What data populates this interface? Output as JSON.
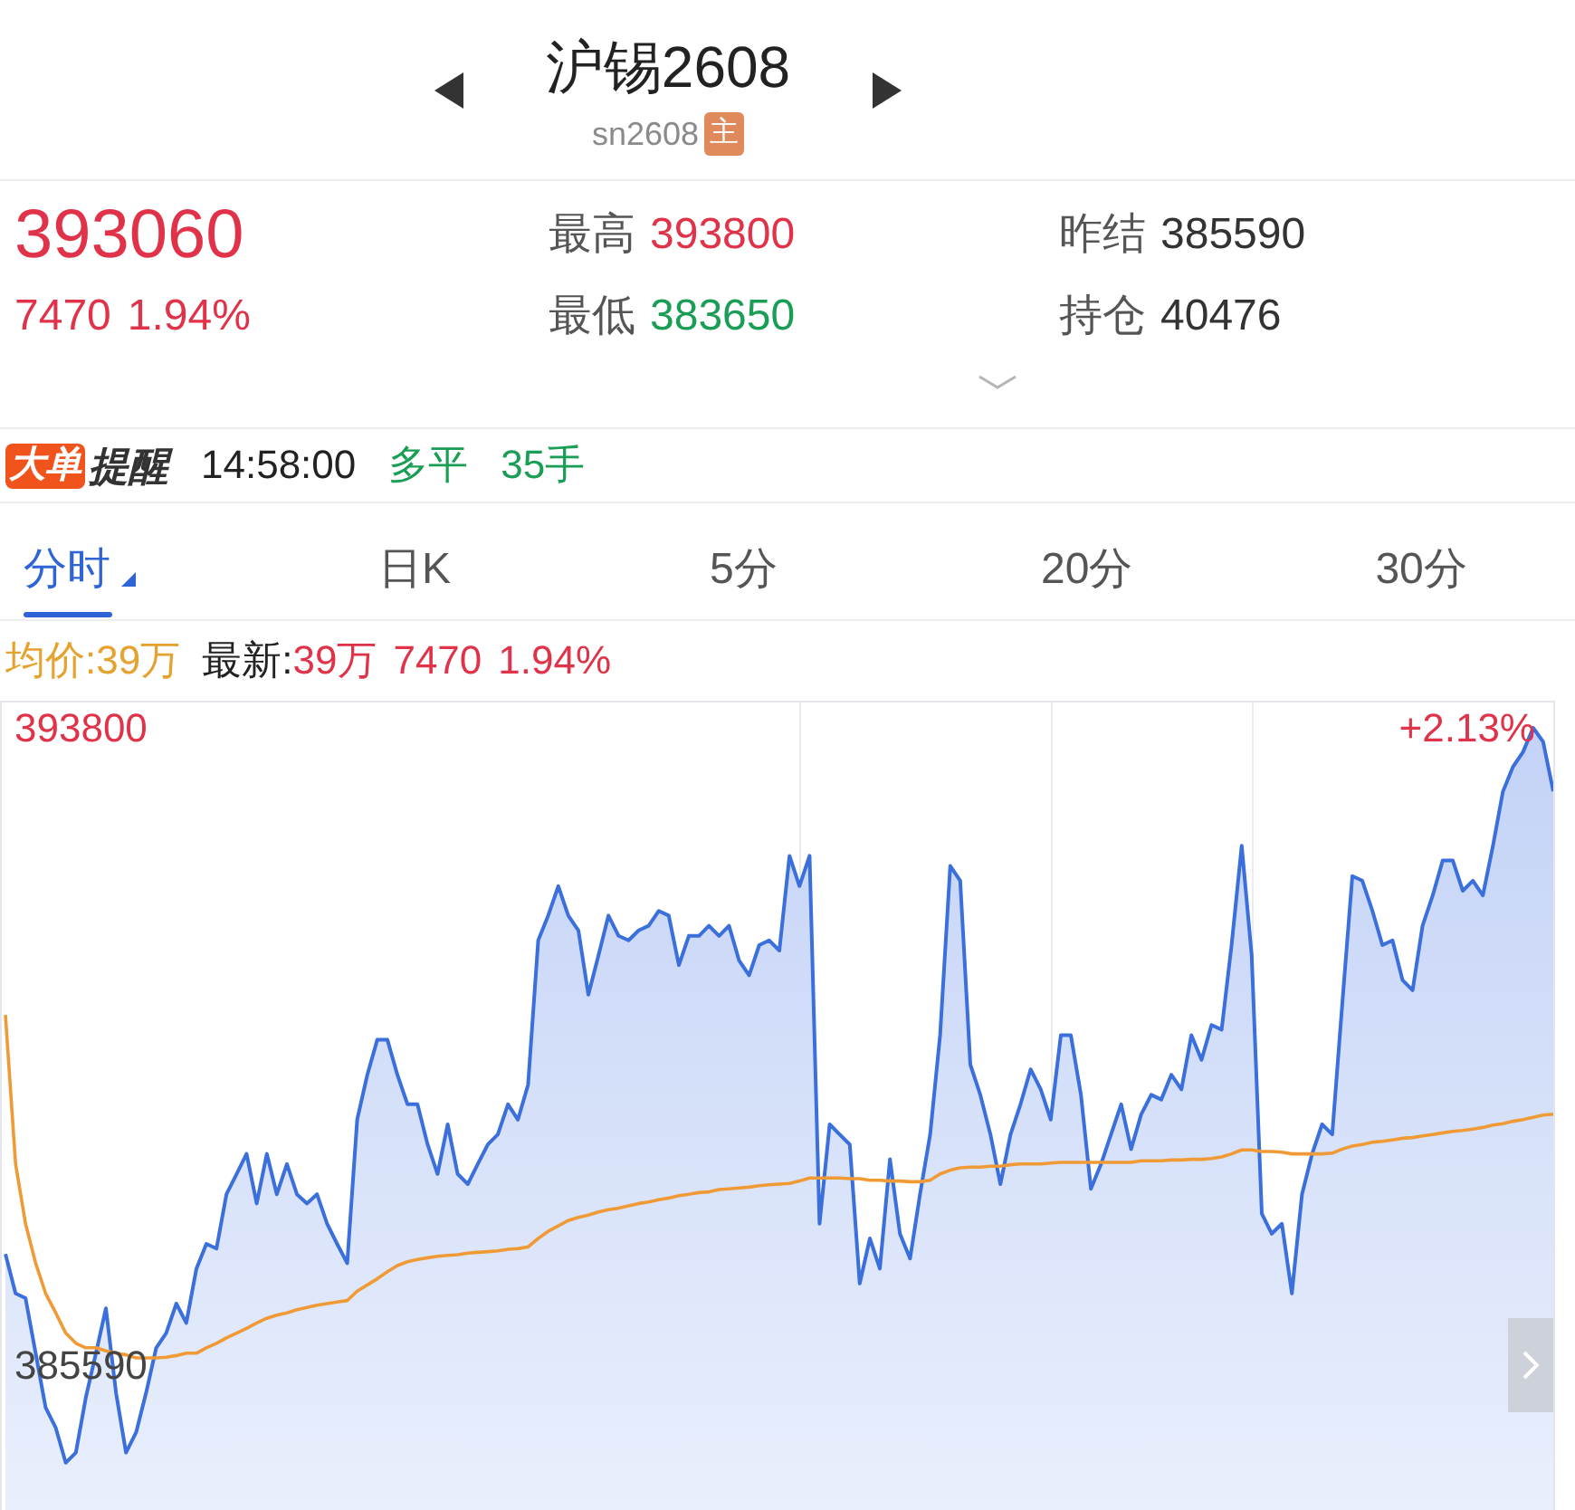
{
  "header": {
    "title": "沪锡2608",
    "code": "sn2608",
    "badge": "主"
  },
  "quote": {
    "price": "393060",
    "change": "7470",
    "change_pct": "1.94%",
    "stats": [
      {
        "label": "最高",
        "value": "393800",
        "color": "#e0334a"
      },
      {
        "label": "昨结",
        "value": "385590",
        "color": "#333333"
      },
      {
        "label": "最低",
        "value": "383650",
        "color": "#1a9e55"
      },
      {
        "label": "持仓",
        "value": "40476",
        "color": "#333333"
      }
    ]
  },
  "alert": {
    "logo_tag": "大单",
    "logo_text": "提醒",
    "time": "14:58:00",
    "action": "多平",
    "volume": "35手"
  },
  "tabs": [
    {
      "label": "分时",
      "selected": true,
      "dropdown": true
    },
    {
      "label": "日K",
      "selected": false,
      "dropdown": false
    },
    {
      "label": "5分",
      "selected": false,
      "dropdown": false
    },
    {
      "label": "20分",
      "selected": false,
      "dropdown": false
    },
    {
      "label": "30分",
      "selected": false,
      "dropdown": false
    }
  ],
  "legend": {
    "average": "均价:39万",
    "latest_label": "最新:",
    "latest_value": "39万",
    "change": "7470",
    "change_pct": "1.94%"
  },
  "chart": {
    "right_label": "+2.13%",
    "chart_data": {
      "type": "area",
      "ylim": [
        383720,
        394150
      ],
      "yticks": [
        {
          "value": 385590,
          "label": "385590"
        },
        {
          "value": 393800,
          "label": "393800"
        }
      ],
      "series": [
        {
          "color": "#3a6fdc",
          "values": [
            387020,
            386510,
            386450,
            385740,
            385040,
            384780,
            384330,
            384460,
            385170,
            385740,
            386320,
            385230,
            384460,
            384720,
            385230,
            385810,
            386000,
            386380,
            386130,
            386830,
            387150,
            387090,
            387790,
            388050,
            388310,
            387670,
            388310,
            387790,
            388180,
            387790,
            387670,
            387790,
            387410,
            387150,
            386900,
            388750,
            389330,
            389780,
            389780,
            389330,
            388950,
            388950,
            388430,
            388050,
            388690,
            388050,
            387920,
            388180,
            388430,
            388560,
            388950,
            388750,
            389200,
            391060,
            391380,
            391760,
            391380,
            391190,
            390360,
            390870,
            391380,
            391120,
            391060,
            391190,
            391250,
            391440,
            391380,
            390740,
            391120,
            391120,
            391250,
            391120,
            391250,
            390800,
            390610,
            391000,
            391060,
            390930,
            392150,
            391760,
            392150,
            387410,
            388690,
            388560,
            388430,
            386640,
            387220,
            386830,
            388240,
            387280,
            386960,
            387790,
            388560,
            389840,
            392020,
            391830,
            389460,
            389070,
            388560,
            387920,
            388560,
            388950,
            389400,
            389140,
            388750,
            389840,
            389840,
            389070,
            387860,
            388180,
            388560,
            388950,
            388370,
            388820,
            389070,
            389010,
            389330,
            389140,
            389840,
            389520,
            389970,
            389910,
            391000,
            392280,
            390870,
            387540,
            387280,
            387410,
            386510,
            387790,
            388310,
            388690,
            388560,
            390230,
            391890,
            391830,
            391440,
            391000,
            391060,
            390550,
            390420,
            391250,
            391640,
            392090,
            392090,
            391700,
            391830,
            391640,
            392280,
            392980,
            393300,
            393490,
            393800,
            393620,
            392980
          ]
        },
        {
          "type": "line",
          "color": "#f09a36",
          "values": [
            390100,
            388180,
            387410,
            386900,
            386510,
            386260,
            386000,
            385870,
            385810,
            385810,
            385770,
            385740,
            385720,
            385680,
            385680,
            385680,
            385690,
            385710,
            385740,
            385740,
            385810,
            385870,
            385940,
            386000,
            386060,
            386130,
            386190,
            386230,
            386260,
            386300,
            386330,
            386360,
            386380,
            386400,
            386420,
            386540,
            386620,
            386700,
            386790,
            386870,
            386920,
            386950,
            386970,
            386990,
            387000,
            387010,
            387030,
            387040,
            387050,
            387060,
            387080,
            387090,
            387110,
            387220,
            387310,
            387380,
            387450,
            387490,
            387520,
            387560,
            387590,
            387610,
            387640,
            387670,
            387690,
            387720,
            387740,
            387770,
            387790,
            387810,
            387820,
            387850,
            387860,
            387870,
            387880,
            387900,
            387910,
            387920,
            387930,
            387960,
            388000,
            388000,
            388000,
            388000,
            387990,
            387990,
            387970,
            387970,
            387960,
            387960,
            387950,
            387950,
            387970,
            388050,
            388100,
            388130,
            388140,
            388140,
            388150,
            388150,
            388170,
            388180,
            388180,
            388180,
            388190,
            388200,
            388200,
            388200,
            388200,
            388200,
            388200,
            388200,
            388200,
            388220,
            388220,
            388220,
            388230,
            388230,
            388240,
            388240,
            388250,
            388270,
            388310,
            388360,
            388360,
            388340,
            388340,
            388330,
            388310,
            388310,
            388310,
            388310,
            388320,
            388370,
            388410,
            388430,
            388460,
            388470,
            388490,
            388510,
            388520,
            388540,
            388560,
            388580,
            388600,
            388610,
            388630,
            388650,
            388680,
            388700,
            388730,
            388750,
            388780,
            388810,
            388820
          ]
        }
      ]
    }
  }
}
